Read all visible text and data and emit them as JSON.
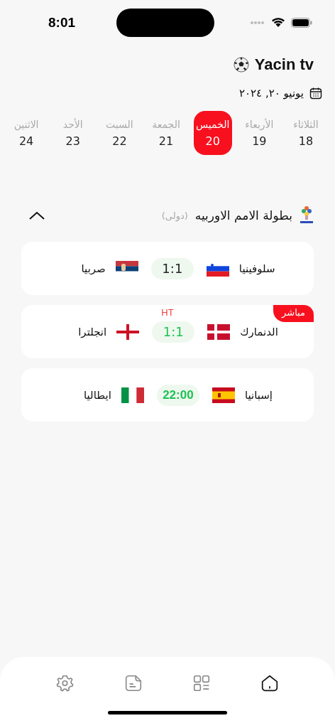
{
  "status_bar": {
    "time": "8:01"
  },
  "header": {
    "title": "Yacin tv"
  },
  "date": {
    "label": "يونيو ٢٠, ٢٠٢٤"
  },
  "days": [
    {
      "name": "الثلاثاء",
      "number": "18",
      "selected": false
    },
    {
      "name": "الأربعاء",
      "number": "19",
      "selected": false
    },
    {
      "name": "الخميس",
      "number": "20",
      "selected": true
    },
    {
      "name": "الجمعة",
      "number": "21",
      "selected": false
    },
    {
      "name": "السبت",
      "number": "22",
      "selected": false
    },
    {
      "name": "الأحد",
      "number": "23",
      "selected": false
    },
    {
      "name": "الاثنين",
      "number": "24",
      "selected": false
    }
  ],
  "league": {
    "name": "بطولة الامم الاوربيه",
    "tag": "(دولى)",
    "expanded": true,
    "matches": [
      {
        "home": {
          "name": "سلوفينيا",
          "kind": "slovenia"
        },
        "away": {
          "name": "صربيا",
          "kind": "serbia"
        },
        "center": "1:1",
        "kind": "finished",
        "live": false
      },
      {
        "home": {
          "name": "الدنمارك",
          "kind": "denmark"
        },
        "away": {
          "name": "انجلترا",
          "kind": "england"
        },
        "center": "1:1",
        "kind": "live",
        "live": true,
        "badge": "مباشر",
        "status": "HT"
      },
      {
        "home": {
          "name": "إسبانيا",
          "kind": "spain"
        },
        "away": {
          "name": "ايطاليا",
          "kind": "italy"
        },
        "center": "22:00",
        "kind": "upcoming",
        "live": false
      }
    ]
  },
  "nav": [
    {
      "kind": "settings",
      "selected": false
    },
    {
      "kind": "document",
      "selected": false
    },
    {
      "kind": "grid",
      "selected": false
    },
    {
      "kind": "home",
      "selected": true
    }
  ]
}
